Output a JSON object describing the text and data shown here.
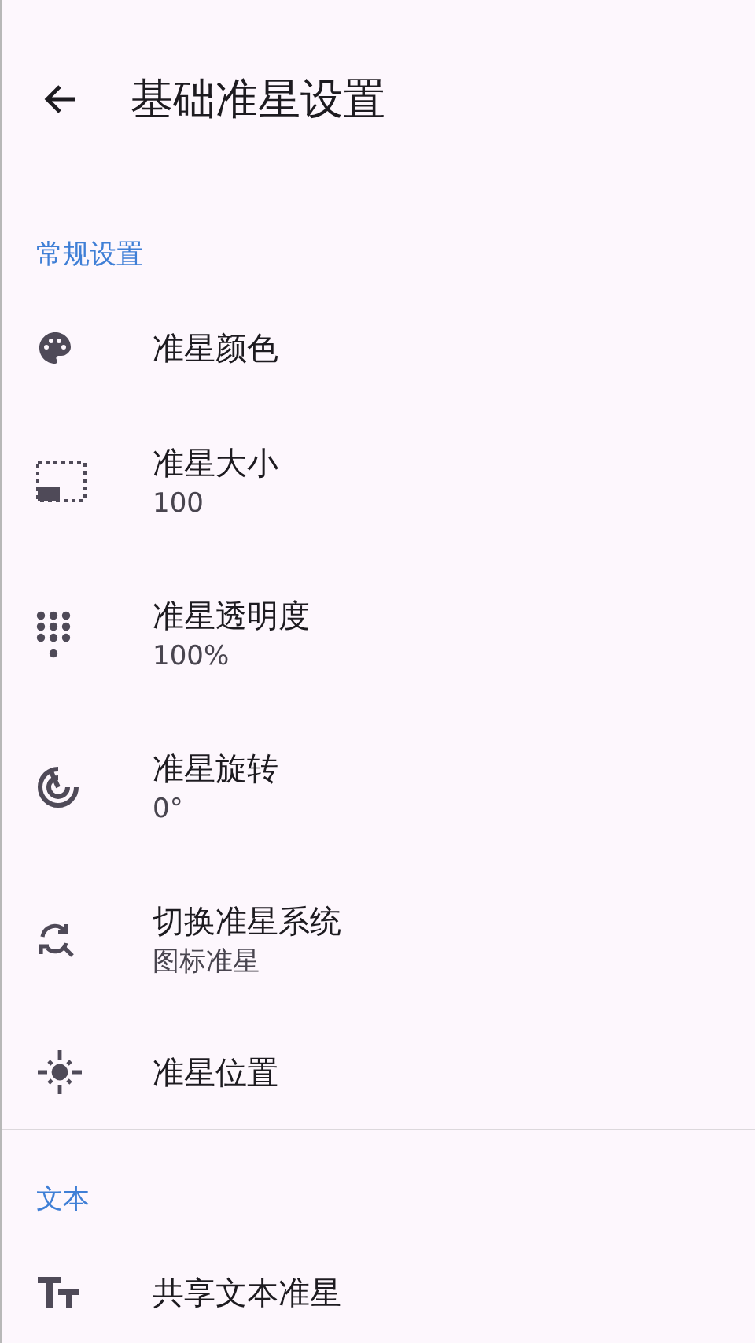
{
  "header": {
    "title": "基础准星设置"
  },
  "sections": [
    {
      "title": "常规设置",
      "items": [
        {
          "kind": "palette",
          "title": "准星颜色"
        },
        {
          "kind": "resize",
          "title": "准星大小",
          "summary": "100"
        },
        {
          "kind": "dots",
          "title": "准星透明度",
          "summary": "100%"
        },
        {
          "kind": "rotate",
          "title": "准星旋转",
          "summary": "0°"
        },
        {
          "kind": "switch",
          "title": "切换准星系统",
          "summary": "图标准星"
        },
        {
          "kind": "position",
          "title": "准星位置"
        }
      ]
    },
    {
      "title": "文本",
      "items": [
        {
          "kind": "text",
          "title": "共享文本准星"
        }
      ]
    }
  ]
}
